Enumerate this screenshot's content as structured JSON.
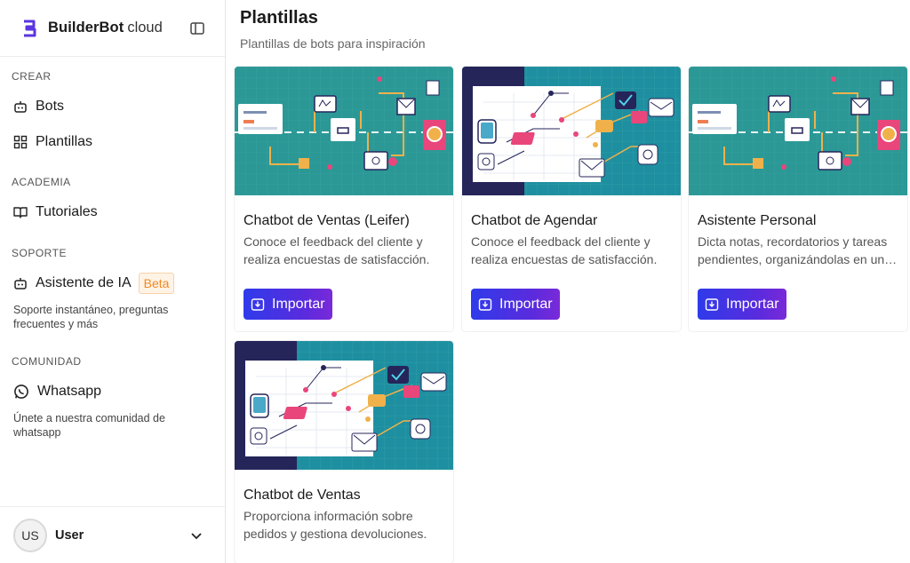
{
  "brand": {
    "name": "BuilderBot",
    "suffix": "cloud"
  },
  "sidebar": {
    "sections": [
      {
        "title": "CREAR"
      },
      {
        "title": "ACADEMIA"
      },
      {
        "title": "SOPORTE"
      },
      {
        "title": "COMUNIDAD"
      }
    ],
    "items": {
      "bots": "Bots",
      "plantillas": "Plantillas",
      "tutoriales": "Tutoriales",
      "asistente": "Asistente de IA",
      "asistente_badge": "Beta",
      "asistente_desc": "Soporte instantáneo, preguntas frecuentes y más",
      "whatsapp": "Whatsapp",
      "whatsapp_desc": "Únete a nuestra comunidad de whatsapp"
    },
    "user": {
      "initials": "US",
      "name": "User"
    }
  },
  "main": {
    "title": "Plantillas",
    "subtitle": "Plantillas de bots para inspiración",
    "import_label": "Importar",
    "cards": [
      {
        "title": "Chatbot de Ventas (Leifer)",
        "desc": "Conoce el feedback del cliente y realiza encuestas de satisfacción.",
        "illustration": "flow-diagram"
      },
      {
        "title": "Chatbot de Agendar",
        "desc": "Conoce el feedback del cliente y realiza encuestas de satisfacción.",
        "illustration": "chat-workflow"
      },
      {
        "title": "Asistente Personal",
        "desc": "Dicta notas, recordatorios y tareas pendientes, organizándolas en un…",
        "illustration": "flow-diagram"
      },
      {
        "title": "Chatbot de Ventas",
        "desc": "Proporciona información sobre pedidos y gestiona devoluciones.",
        "illustration": "chat-workflow"
      }
    ]
  },
  "colors": {
    "accent_start": "#2f3bea",
    "accent_end": "#7a2ad8",
    "teal": "#2a9d9b",
    "navy": "#25255a",
    "beta": "#f08a24"
  }
}
